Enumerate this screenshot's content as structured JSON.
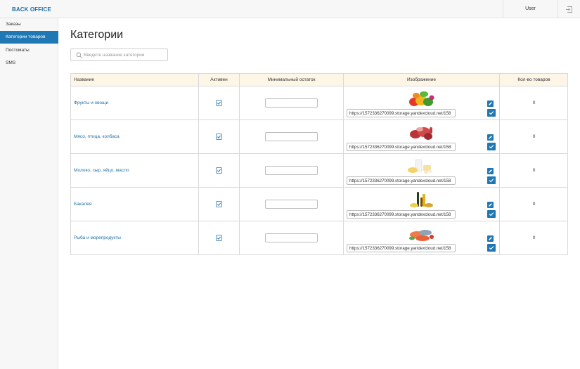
{
  "brand": "BACK OFFICE",
  "user": "User",
  "icons": {
    "logout": "logout-icon",
    "search": "search-icon",
    "edit": "pencil-icon",
    "confirm": "check-icon"
  },
  "accent_color": "#1f78b4",
  "sidebar": {
    "items": [
      {
        "label": "Заказы",
        "active": false
      },
      {
        "label": "Категории товаров",
        "active": true
      },
      {
        "label": "Постоматы",
        "active": false
      },
      {
        "label": "SMS",
        "active": false
      }
    ]
  },
  "page": {
    "title": "Категории"
  },
  "search": {
    "placeholder": "Введите название категории",
    "value": ""
  },
  "table": {
    "headers": {
      "name": "Название",
      "active": "Активен",
      "min": "Минимальный остаток",
      "image": "Изображение",
      "count": "Кол-во товаров"
    },
    "rows": [
      {
        "name": "Фрукты и овощи",
        "active": true,
        "min": "",
        "image_url": "https://1572336270099.storage.yandexcloud.net/158",
        "image": "fruits-vegetables-image",
        "count": "0"
      },
      {
        "name": "Мясо, птица, колбаса",
        "active": true,
        "min": "",
        "image_url": "https://1572336270099.storage.yandexcloud.net/158",
        "image": "meat-poultry-image",
        "count": "0"
      },
      {
        "name": "Молоко, сыр, яйцо, масло",
        "active": true,
        "min": "",
        "image_url": "https://1572336270099.storage.yandexcloud.net/158",
        "image": "dairy-eggs-image",
        "count": "0"
      },
      {
        "name": "Бакалея",
        "active": true,
        "min": "",
        "image_url": "https://1572336270099.storage.yandexcloud.net/158",
        "image": "grocery-bottles-image",
        "count": "0"
      },
      {
        "name": "Рыба и морепродукты",
        "active": true,
        "min": "",
        "image_url": "https://1572336270099.storage.yandexcloud.net/158",
        "image": "fish-seafood-image",
        "count": "0"
      }
    ]
  }
}
